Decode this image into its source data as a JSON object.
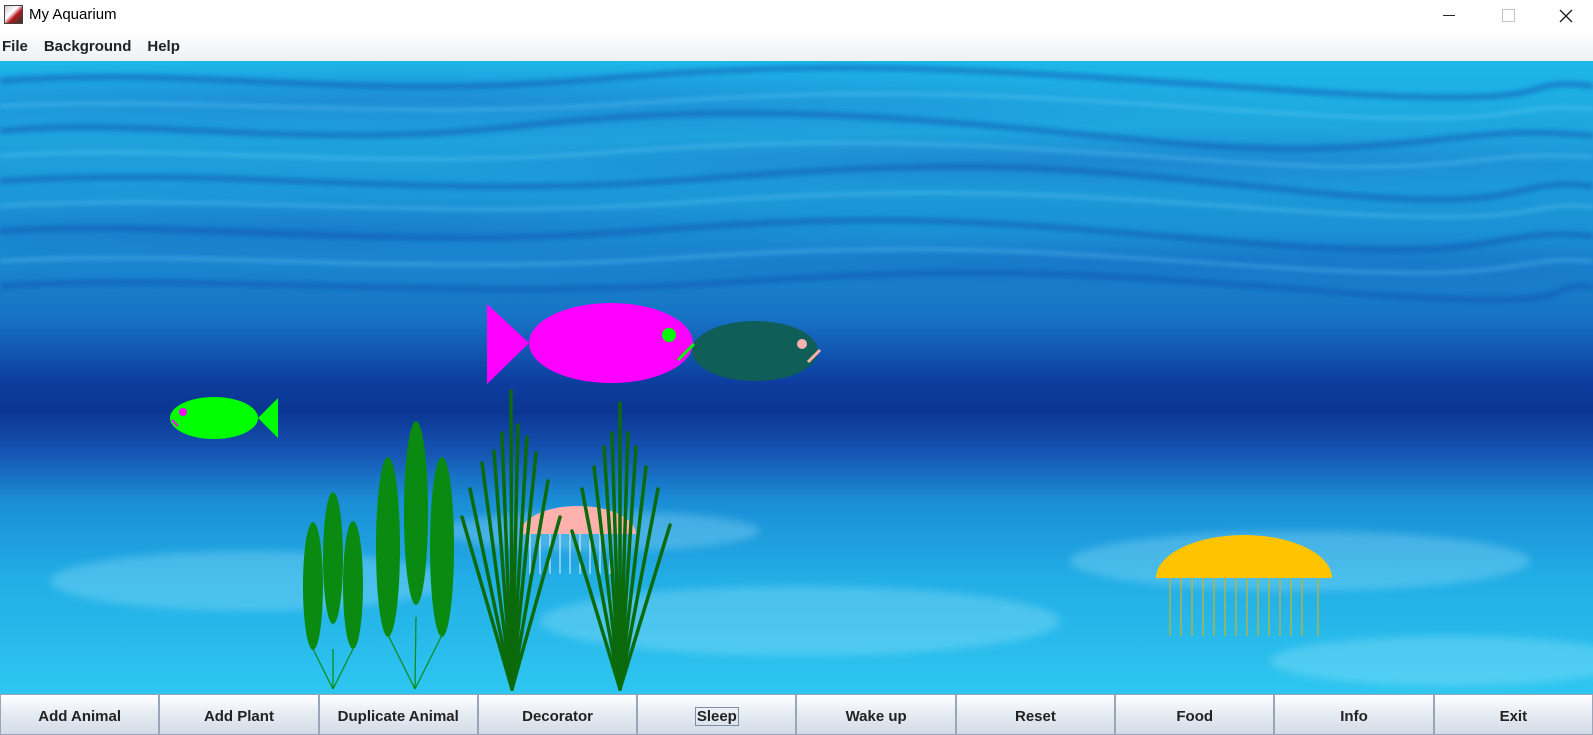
{
  "window": {
    "title": "My Aquarium",
    "controls": {
      "minimize": "minimize-icon",
      "maximize": "maximize-icon",
      "close": "close-icon"
    }
  },
  "menu": {
    "items": [
      {
        "label": "File"
      },
      {
        "label": "Background"
      },
      {
        "label": "Help"
      }
    ]
  },
  "aquarium": {
    "background": "underwater-sea-image",
    "colors": {
      "fish_magenta": "#ff00ff",
      "fish_dark_teal": "#0f5e58",
      "fish_green": "#00ff00",
      "jellyfish_pink": "#ffb0b0",
      "jellyfish_gold": "#ffc400",
      "plant_green": "#0a8a10",
      "plant_dark_green": "#0b6a0b"
    },
    "creatures": [
      {
        "kind": "fish",
        "color": "magenta",
        "facing": "right"
      },
      {
        "kind": "fish",
        "color": "dark-teal",
        "facing": "right"
      },
      {
        "kind": "fish",
        "color": "green",
        "facing": "left"
      },
      {
        "kind": "jellyfish",
        "color": "pink"
      },
      {
        "kind": "jellyfish",
        "color": "gold"
      }
    ],
    "plants": [
      {
        "kind": "leafy-plant"
      },
      {
        "kind": "leafy-plant"
      },
      {
        "kind": "grass-plant"
      },
      {
        "kind": "grass-plant"
      }
    ]
  },
  "toolbar": {
    "buttons": [
      {
        "label": "Add Animal"
      },
      {
        "label": "Add Plant"
      },
      {
        "label": "Duplicate Animal"
      },
      {
        "label": "Decorator"
      },
      {
        "label": "Sleep"
      },
      {
        "label": "Wake up"
      },
      {
        "label": "Reset"
      },
      {
        "label": "Food"
      },
      {
        "label": "Info"
      },
      {
        "label": "Exit"
      }
    ]
  }
}
